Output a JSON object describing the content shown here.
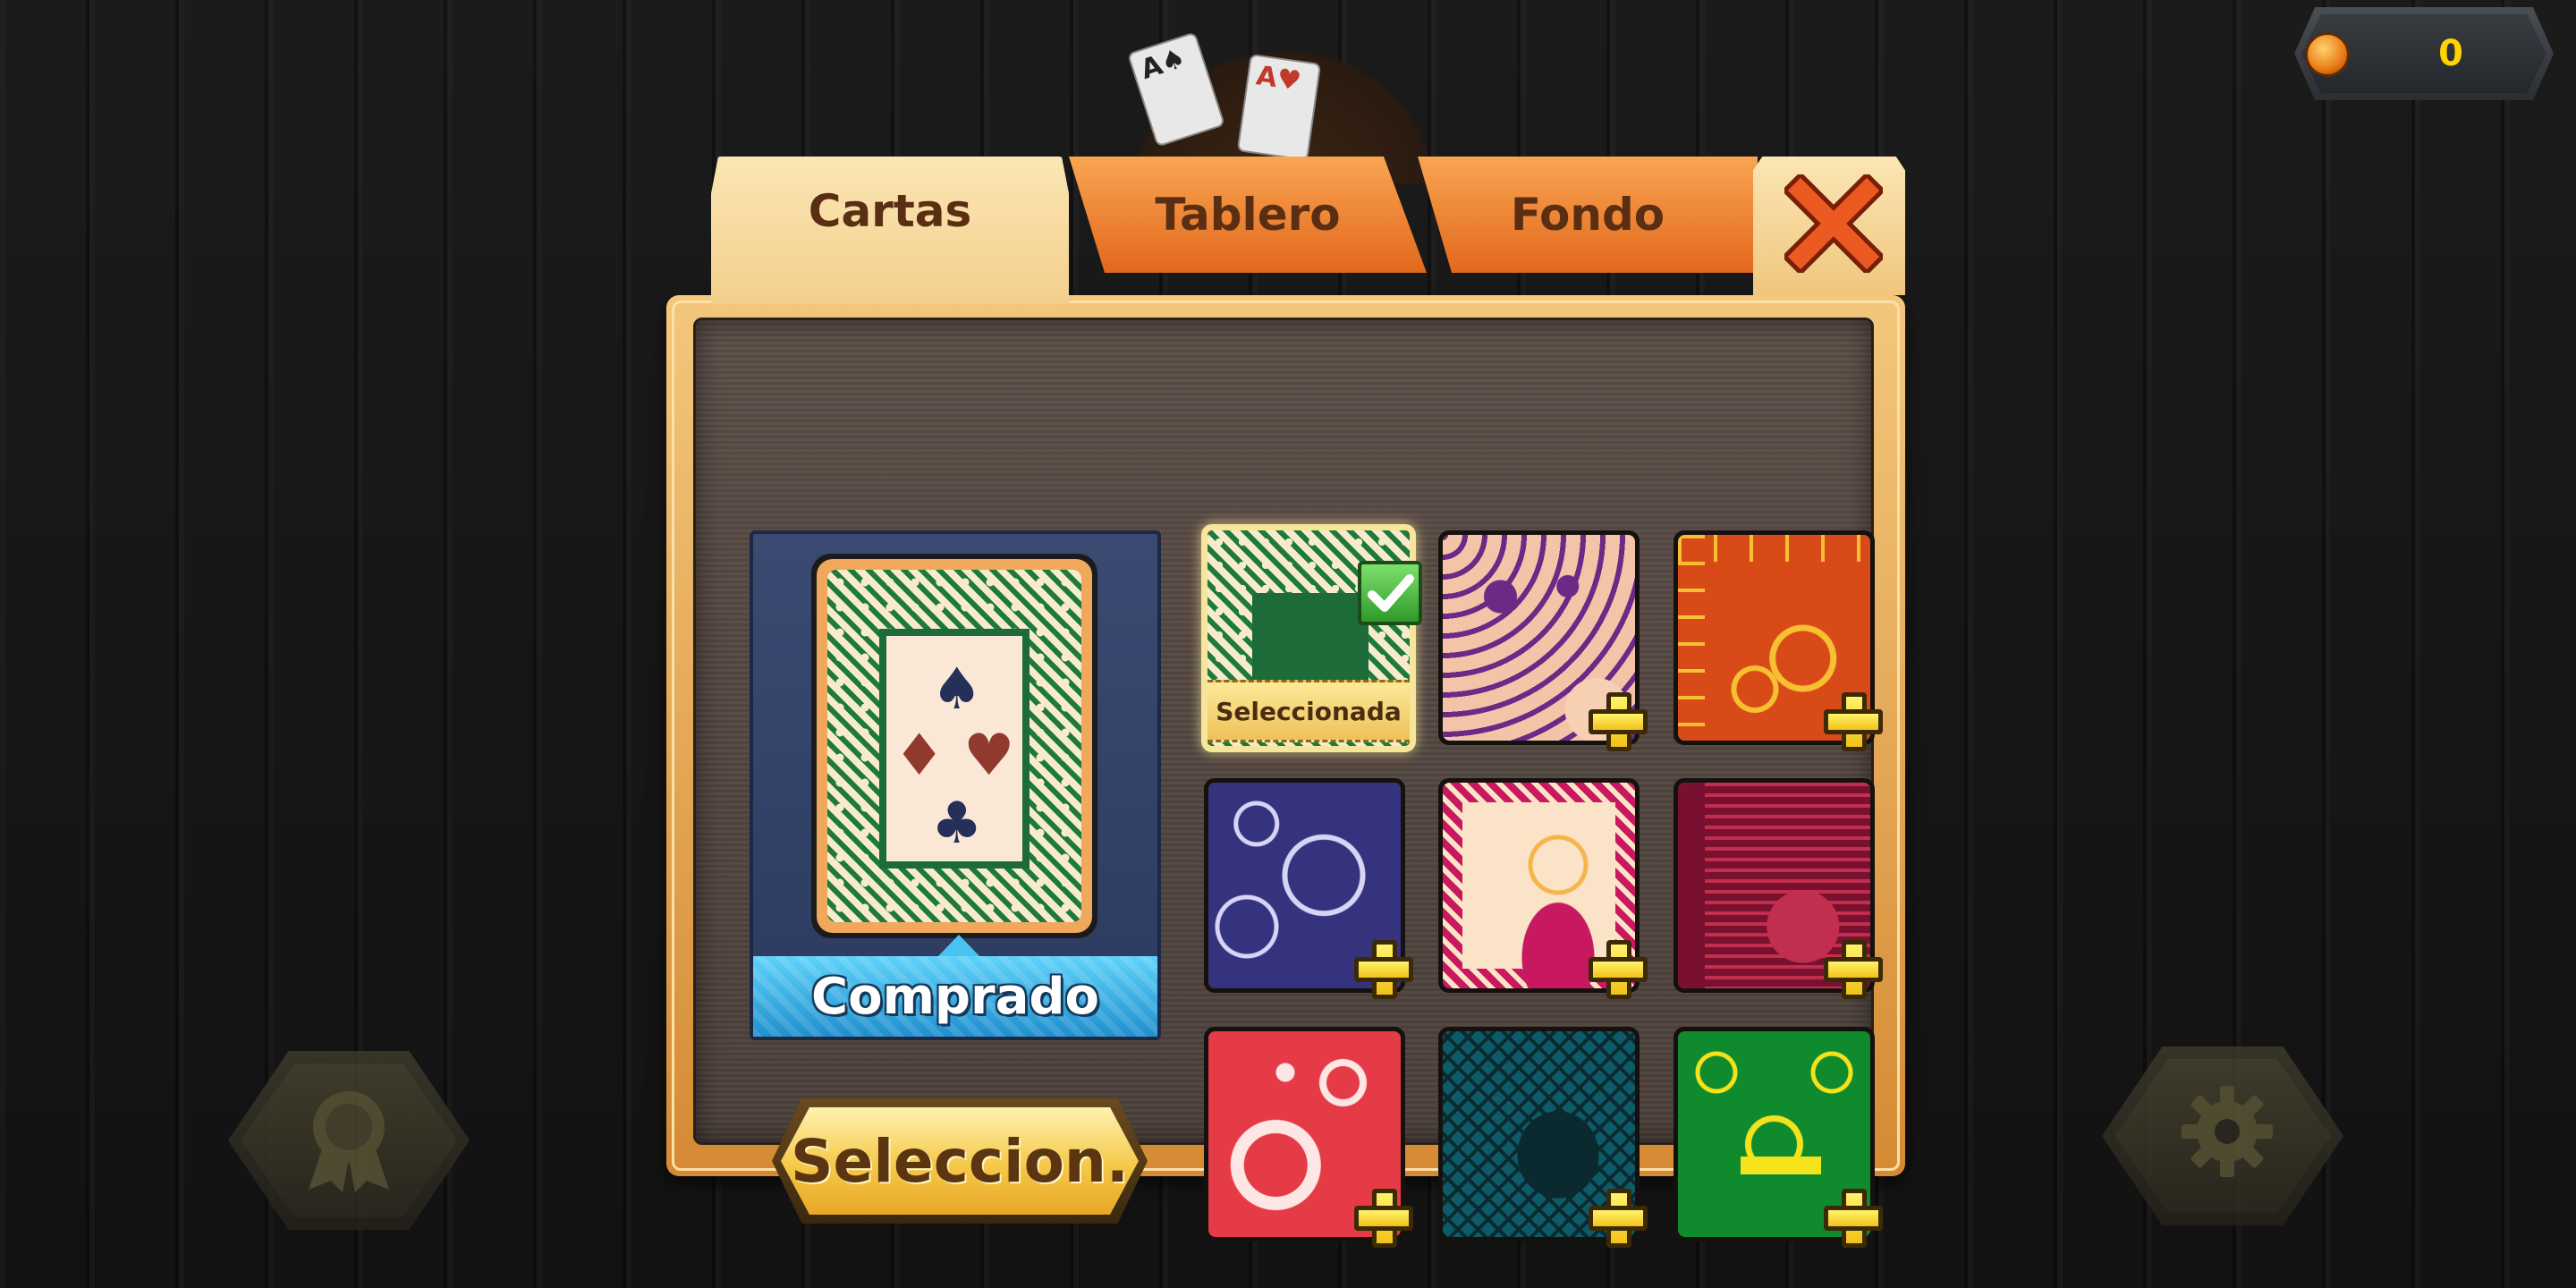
{
  "wallet": {
    "coins": "0",
    "icon": "coin-icon",
    "value_color": "#ffd200"
  },
  "tabs": [
    {
      "label": "Cartas",
      "active": true
    },
    {
      "label": "Tablero",
      "active": false
    },
    {
      "label": "Fondo",
      "active": false
    }
  ],
  "close": {
    "icon": "close-icon",
    "color": "#e0521f"
  },
  "preview": {
    "status": "Comprado",
    "status_color": "#2ea7e0",
    "suits": [
      "♠",
      "♦",
      "♥",
      "♣"
    ]
  },
  "actions": {
    "select_label": "Seleccion."
  },
  "card_backs": [
    {
      "name": "green-lattice",
      "selected": true,
      "status": "Seleccionada",
      "colors": [
        "#1d7a3c",
        "#f7eacd"
      ]
    },
    {
      "name": "purple-floral",
      "locked": true,
      "colors": [
        "#6a2a86",
        "#f3c4a8"
      ]
    },
    {
      "name": "orange-scroll",
      "locked": true,
      "colors": [
        "#d94a19",
        "#f6c030"
      ]
    },
    {
      "name": "navy-swirl",
      "locked": true,
      "colors": [
        "#35327e",
        "#d8d4f5"
      ]
    },
    {
      "name": "pink-lotus",
      "locked": true,
      "colors": [
        "#c8185f",
        "#fbe3c8"
      ]
    },
    {
      "name": "crimson-damask",
      "locked": true,
      "colors": [
        "#7a1030",
        "#c22f4e"
      ]
    },
    {
      "name": "coral-flourish",
      "locked": true,
      "colors": [
        "#e53b46",
        "#fde6e4"
      ]
    },
    {
      "name": "teal-lace",
      "locked": true,
      "colors": [
        "#0d5b68",
        "#0a2a30"
      ]
    },
    {
      "name": "green-crown",
      "locked": true,
      "colors": [
        "#0f8a2c",
        "#f4e21c"
      ]
    }
  ],
  "background_buttons": {
    "left_icon": "ribbon-icon",
    "right_icon": "gear-icon"
  }
}
